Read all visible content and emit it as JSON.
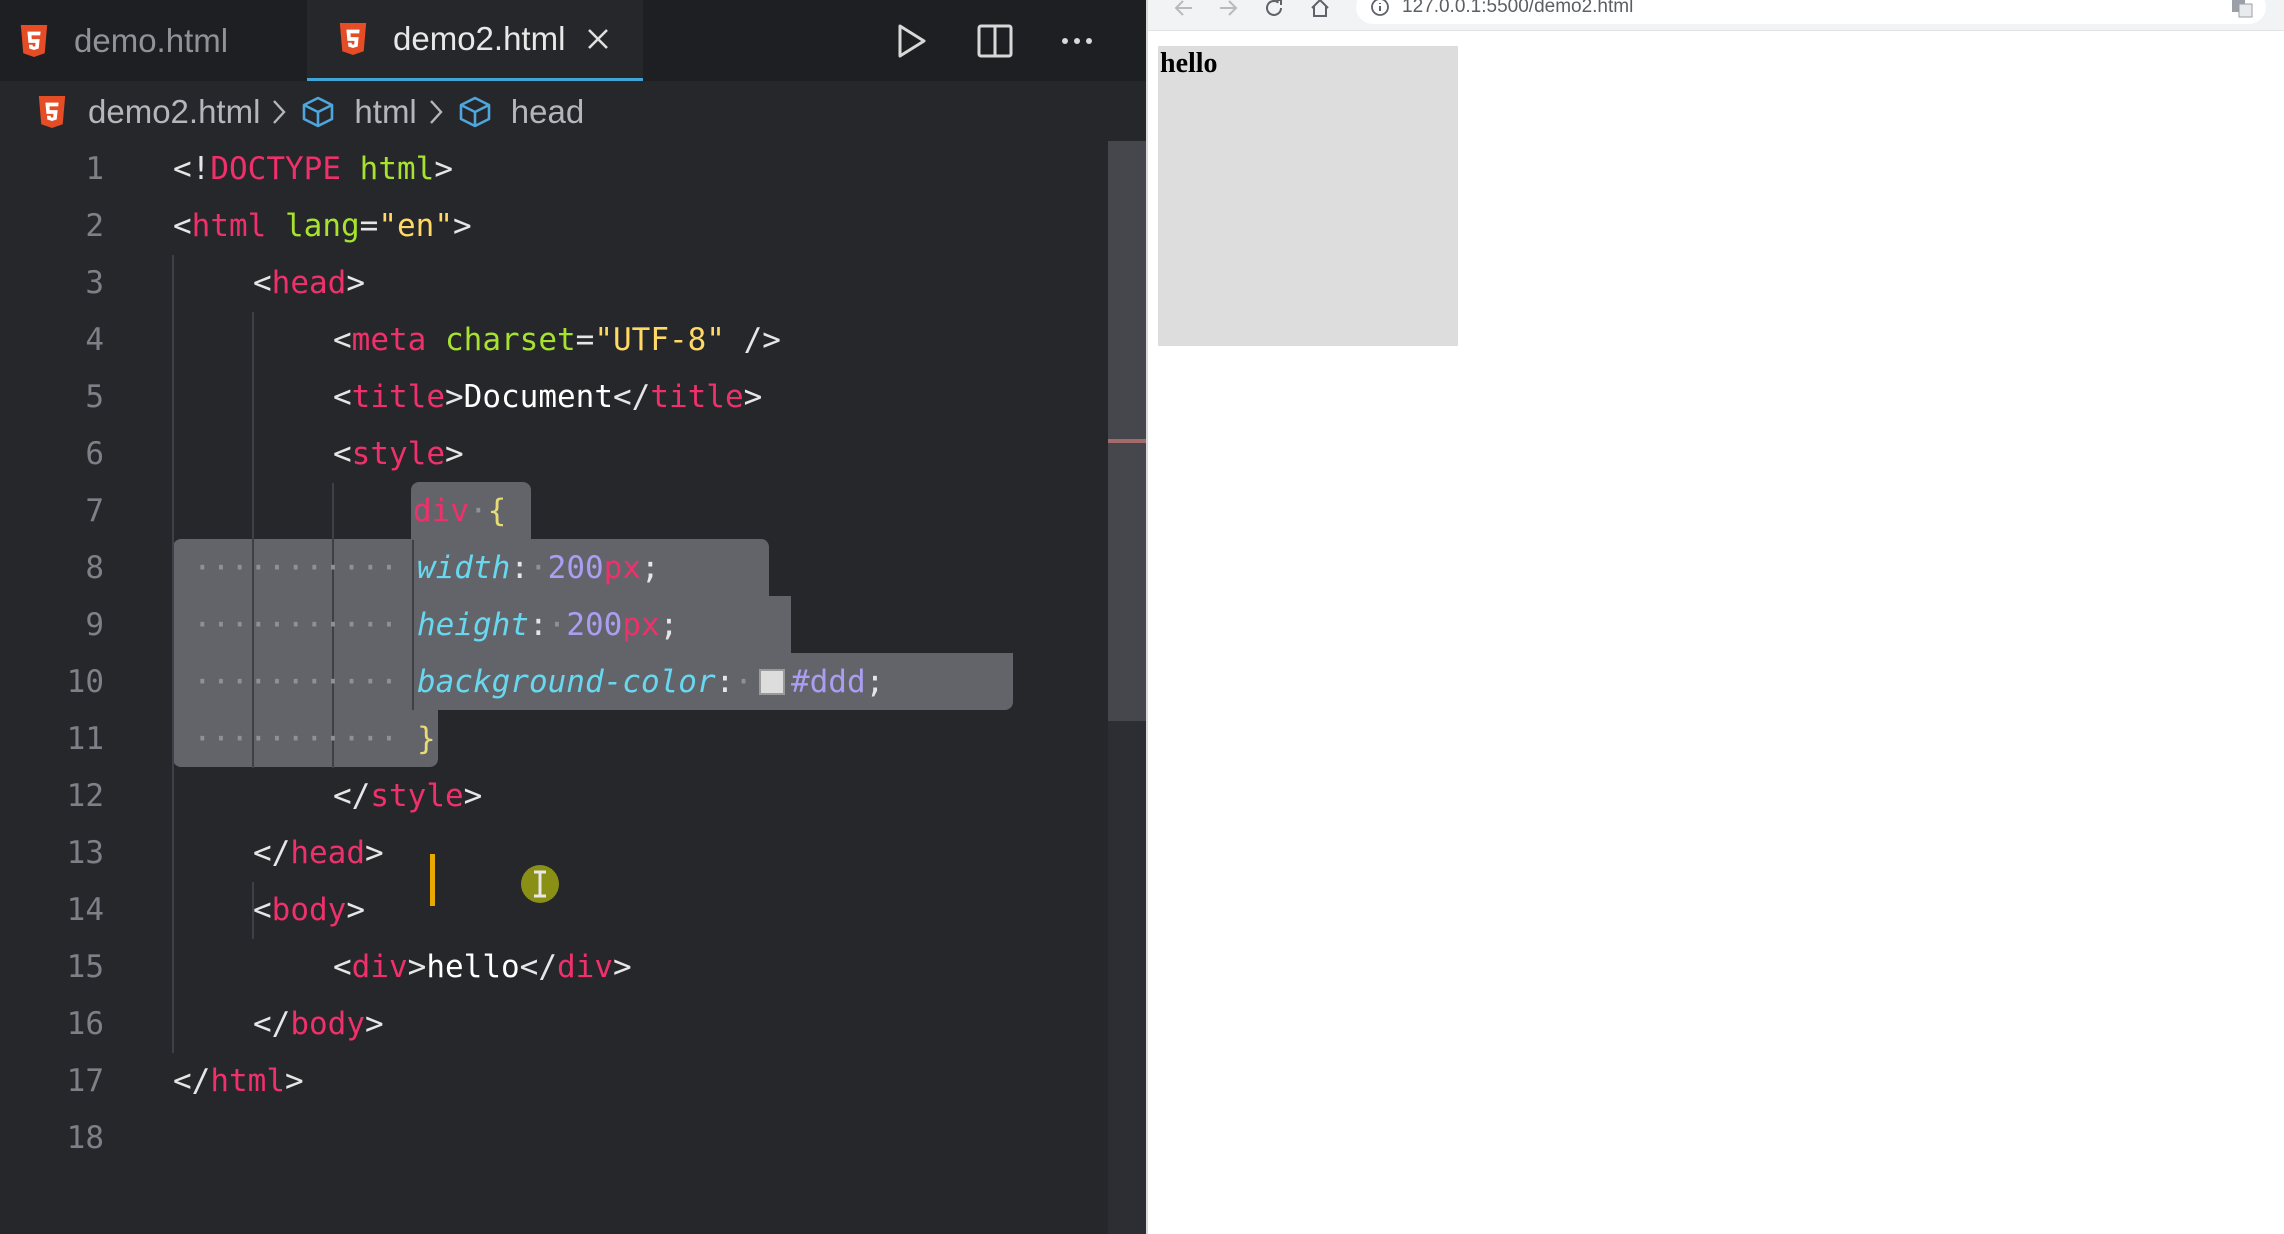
{
  "editor": {
    "tabs": [
      {
        "label": "demo.html",
        "icon": "html5-icon"
      },
      {
        "label": "demo2.html",
        "icon": "html5-icon",
        "active": true
      }
    ],
    "toolbar": [
      "run-icon",
      "split-editor-icon",
      "more-actions-icon"
    ],
    "breadcrumb": [
      "demo2.html",
      "html",
      "head"
    ],
    "line_numbers": [
      "1",
      "2",
      "3",
      "4",
      "5",
      "6",
      "7",
      "8",
      "9",
      "10",
      "11",
      "12",
      "13",
      "14",
      "15",
      "16",
      "17",
      "18"
    ],
    "code": {
      "l1": {
        "lt": "<",
        "bang": "!",
        "doctype": "DOCTYPE",
        "html": "html",
        "gt": ">"
      },
      "l2": {
        "lt": "<",
        "tag": "html",
        "attr": "lang",
        "eq": "=",
        "val": "\"en\"",
        "gt": ">"
      },
      "l3": {
        "lt": "<",
        "tag": "head",
        "gt": ">"
      },
      "l4": {
        "lt": "<",
        "tag": "meta",
        "attr": "charset",
        "eq": "=",
        "val": "\"UTF-8\"",
        "end": " />"
      },
      "l5": {
        "lt": "<",
        "tag": "title",
        "gt": ">",
        "text": "Document",
        "close_lt": "</",
        "close_tag": "title",
        "close_gt": ">"
      },
      "l6": {
        "lt": "<",
        "tag": "style",
        "gt": ">"
      },
      "l7": {
        "selector": "div",
        "brace": "{"
      },
      "l8": {
        "prop": "width",
        "colon": ":",
        "num": "200",
        "unit": "px",
        "semi": ";"
      },
      "l9": {
        "prop": "height",
        "colon": ":",
        "num": "200",
        "unit": "px",
        "semi": ";"
      },
      "l10": {
        "prop": "background-color",
        "colon": ":",
        "value": "#ddd",
        "semi": ";",
        "swatch": "#dddddd"
      },
      "l11": {
        "brace": "}"
      },
      "l12": {
        "close_lt": "</",
        "tag": "style",
        "gt": ">"
      },
      "l13": {
        "close_lt": "</",
        "tag": "head",
        "gt": ">"
      },
      "l14": {
        "lt": "<",
        "tag": "body",
        "gt": ">"
      },
      "l15": {
        "lt": "<",
        "tag": "div",
        "gt": ">",
        "text": "hello",
        "close_lt": "</",
        "close_tag": "div",
        "close_gt": ">"
      },
      "l16": {
        "close_lt": "</",
        "tag": "body",
        "gt": ">"
      },
      "l17": {
        "close_lt": "</",
        "tag": "html",
        "gt": ">"
      }
    }
  },
  "browser": {
    "url": "127.0.0.1:5500/demo2.html",
    "nav_icons": [
      "back-icon",
      "forward-icon",
      "reload-icon",
      "home-icon",
      "info-icon",
      "translate-icon"
    ],
    "page_text": "hello",
    "box_color": "#dddddd"
  },
  "colors": {
    "editor_bg": "#25272b",
    "tab_active_border": "#3ea5d6",
    "html5_orange": "#e44d26",
    "tag_pink": "#f0306a",
    "attr_green": "#a6e22e",
    "string_yellow": "#ffd866",
    "prop_cyan": "#67d8ef",
    "number_purple": "#ab9df2",
    "caret": "#e8a900"
  }
}
